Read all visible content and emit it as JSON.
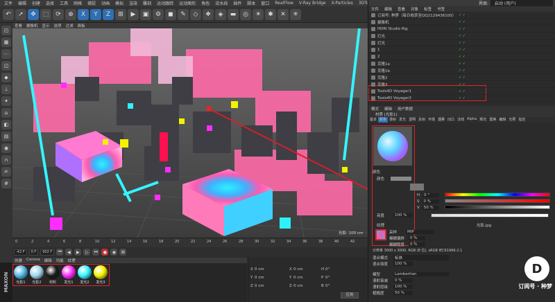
{
  "menubar": [
    "文件",
    "编辑",
    "创建",
    "选择",
    "工具",
    "网格",
    "捕捉",
    "动画",
    "模拟",
    "渲染",
    "雕刻",
    "运动跟踪",
    "运动图形",
    "角色",
    "流水线",
    "插件",
    "脚本",
    "窗口",
    "RealFlow",
    "V-Ray Bridge",
    "X-Particles",
    "3DToAll",
    "Corona",
    "脚本",
    "帮助"
  ],
  "layout_label": "界面:",
  "layout_value": "启动 (用户)",
  "toolbar_axes": [
    "X",
    "Y",
    "Z"
  ],
  "viewport_menu": [
    "查看",
    "摄像机",
    "显示",
    "选项",
    "过滤",
    "面板"
  ],
  "timeline": {
    "start": "0",
    "end": "42 F",
    "frame": "0 F",
    "ticks": [
      "0",
      "2",
      "4",
      "6",
      "8",
      "10",
      "12",
      "14",
      "16",
      "18",
      "20",
      "22",
      "24",
      "26",
      "28",
      "30",
      "32",
      "34",
      "36",
      "38",
      "40",
      "42"
    ],
    "corner": "42 F"
  },
  "controls": {
    "min": "-42 F",
    "cur": "0 F",
    "max": "902 F"
  },
  "viewport_status": "光影: 100 cm",
  "mat_menu": [
    "创建",
    "Corona",
    "编辑",
    "功能",
    "纹理"
  ],
  "materials": [
    {
      "label": "光影1",
      "color": "#4fb8e8"
    },
    {
      "label": "光影2",
      "color": "#9fd6ee"
    },
    {
      "label": "材料",
      "color": "#1a1a1a"
    },
    {
      "label": "发光1",
      "color": "#ff2cff"
    },
    {
      "label": "发光2",
      "color": "#34f4ff"
    },
    {
      "label": "发光3",
      "color": "#f4f200"
    }
  ],
  "coords": {
    "x": "0 cm",
    "y": "0 cm",
    "z": "0 cm",
    "px": "0 cm",
    "py": "0 cm",
    "pz": "0 cm",
    "h": "0°",
    "p": "0°",
    "b": "0°",
    "apply": "应用"
  },
  "objects_menu": [
    "文件",
    "编辑",
    "查看",
    "对象",
    "标签",
    "书签"
  ],
  "objects": [
    {
      "name": "订阅号: 种梦（每日收获至QQ2129436100）"
    },
    {
      "name": "摄像机"
    },
    {
      "name": "HDRI Studio Rig"
    },
    {
      "name": "灯光"
    },
    {
      "name": "灯光"
    },
    {
      "name": "1"
    },
    {
      "name": "2"
    },
    {
      "name": "克隆1a"
    },
    {
      "name": "克隆1b"
    },
    {
      "name": "克隆2"
    },
    {
      "name": "克隆3"
    },
    {
      "name": "Tools4D Voyager1"
    },
    {
      "name": "Tools4D Voyager2"
    }
  ],
  "attr_menu": [
    "模式",
    "编辑",
    "用户数据"
  ],
  "attr_title": "材质 [光影1]",
  "attr_tabs": [
    "基本",
    "颜色",
    "漫射",
    "发光",
    "透明",
    "反射",
    "环境",
    "烟雾",
    "凹凸",
    "法线",
    "Alpha",
    "辉光",
    "置换",
    "编辑",
    "光照",
    "指定"
  ],
  "color_section": "颜色",
  "color_label": "颜色",
  "hsv": [
    {
      "k": "H",
      "v": "0 °"
    },
    {
      "k": "S",
      "v": "0 %"
    },
    {
      "k": "V",
      "v": "50 %"
    }
  ],
  "brightness": {
    "label": "亮度",
    "value": "100 %"
  },
  "texture": {
    "label": "纹理",
    "file": "光影.jpg",
    "sample_label": "采样",
    "sample_value": "MIP",
    "blur_offset": "模糊偏移",
    "blur_offset_v": "0 %",
    "blur_scale": "模糊程度",
    "blur_scale_v": "0 %",
    "res": "分辨率 3000 x 3000, RGB (8 位), sRGB IEC61966-2.1"
  },
  "mix_mode": {
    "label": "混合模式",
    "value": "标准"
  },
  "mix_strength": {
    "label": "混合强度",
    "value": "100 %"
  },
  "model": {
    "label": "模型",
    "value": "Lambertian"
  },
  "diffuse_fall": {
    "label": "漫射衰减",
    "value": "0 %"
  },
  "diffuse_level": {
    "label": "漫射层级",
    "value": "100 %"
  },
  "roughness": {
    "label": "粗糙度",
    "value": "50 %"
  },
  "watermark": "订阅号 · 种梦",
  "watermark_logo": "D"
}
